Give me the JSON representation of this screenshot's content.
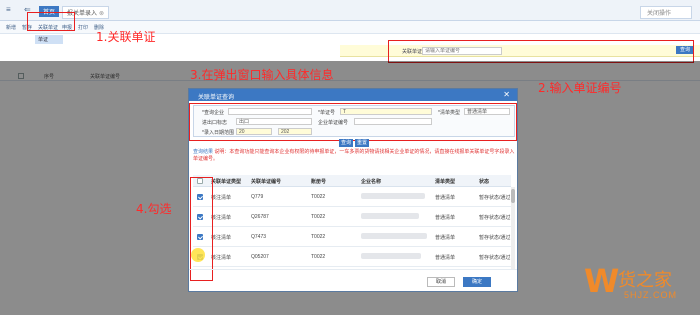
{
  "topbar": {
    "tab_home": "首页",
    "tab_entry": "报关单录入",
    "tab_close": "⊗",
    "right_text": "关闭操作"
  },
  "toolbar": {
    "buttons": [
      "新增",
      "暂存",
      "关联单证",
      "申报",
      "打印",
      "删除"
    ],
    "category": "单证"
  },
  "yellowbar": {
    "label": "关联单证编号",
    "placeholder": "请输入单证编号",
    "button": "查询"
  },
  "list": {
    "headers": [
      "序号",
      "关联单证编号"
    ]
  },
  "annotations": {
    "step1": "1.关联单证",
    "step2": "2.输入单证编号",
    "step3": "3.在弹出窗口输入具体信息",
    "step4": "4.勾选"
  },
  "modal": {
    "title": "关联单证查询",
    "close": "✕",
    "form": {
      "company_label": "*查询企业",
      "company_value": "",
      "doc_no_label": "*单证号",
      "doc_no_value": "T",
      "type_label": "*清单类型",
      "type_value": "普通清单",
      "port_label": "进出口标志",
      "port_value": "出口",
      "doc2_label": "企业单证编号",
      "date_label": "*录入日期范围",
      "date_from": "20",
      "date_to": "202"
    },
    "query_button": "查询",
    "reset_button": "重置",
    "tip_label": "查询结果",
    "tip_text": "说明：本查询功能只能查询本企业有权限的待申报单证，一车多票的货物请找相关企业单证的情况，请直接在线报单关联单证号字段录入单证编号。",
    "grid_headers": [
      "关联单证类型",
      "关联单证编号",
      "账册号",
      "企业名称",
      "清单类型",
      "状态"
    ],
    "rows": [
      {
        "checked": true,
        "type": "核注清单",
        "no": "Q779",
        "book": "T0022",
        "kind": "普通清单",
        "status": "暂存状态/通过"
      },
      {
        "checked": true,
        "type": "核注清单",
        "no": "Q26787",
        "book": "T0022",
        "kind": "普通清单",
        "status": "暂存状态/通过"
      },
      {
        "checked": true,
        "type": "核注清单",
        "no": "Q7473",
        "book": "T0022",
        "kind": "普通清单",
        "status": "暂存状态/通过"
      },
      {
        "checked": true,
        "type": "核注清单",
        "no": "Q05207",
        "book": "T0022",
        "kind": "普通清单",
        "status": "暂存状态/通过"
      }
    ],
    "cancel": "取消",
    "ok": "确定"
  },
  "watermark": {
    "letter": "W",
    "name": "货之家",
    "domain": "5HJZ.COM"
  },
  "colors": {
    "accent": "#3c78c3",
    "annotation": "#ff2a2a",
    "watermark": "#f08a2a"
  }
}
